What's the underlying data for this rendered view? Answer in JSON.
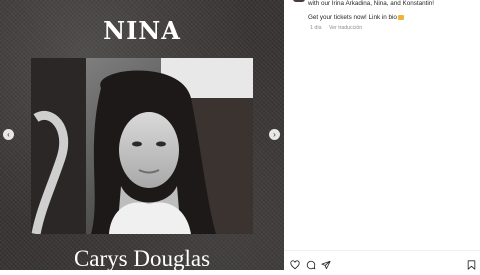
{
  "post": {
    "poster_title": "NINA",
    "poster_name": "Carys Douglas",
    "prev_icon": "chevron-left-icon",
    "next_icon": "chevron-right-icon"
  },
  "caption": {
    "line1": "with our Irina Arkadina, Nina, and Konstantin!",
    "line2": "Get your tickets now! Link in bio"
  },
  "meta": {
    "time": "1 día",
    "translate": "Ver traducción"
  },
  "actions": {
    "icons": [
      "heart-icon",
      "comment-icon",
      "share-icon",
      "bookmark-icon"
    ]
  }
}
